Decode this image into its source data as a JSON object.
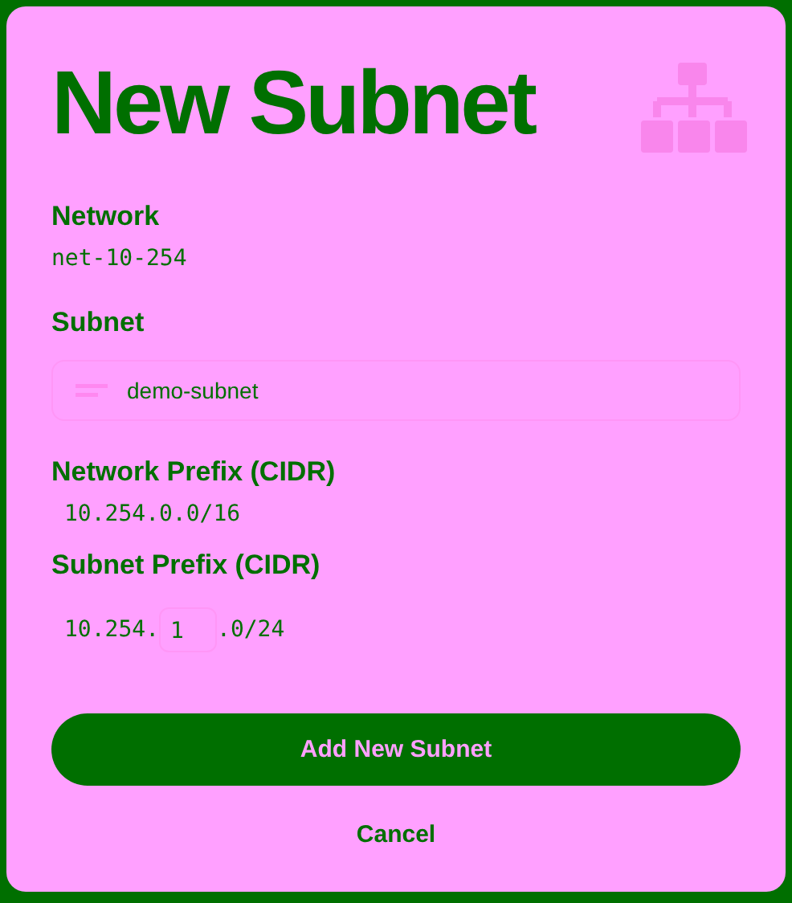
{
  "title": "New Subnet",
  "network": {
    "label": "Network",
    "value": "net-10-254"
  },
  "subnet": {
    "label": "Subnet",
    "value": "demo-subnet"
  },
  "network_prefix": {
    "label": "Network Prefix (CIDR)",
    "value": "10.254.0.0/16"
  },
  "subnet_prefix": {
    "label": "Subnet Prefix (CIDR)",
    "prefix": "10.254.",
    "octet": "1",
    "suffix": ".0/24"
  },
  "buttons": {
    "submit": "Add New Subnet",
    "cancel": "Cancel"
  }
}
